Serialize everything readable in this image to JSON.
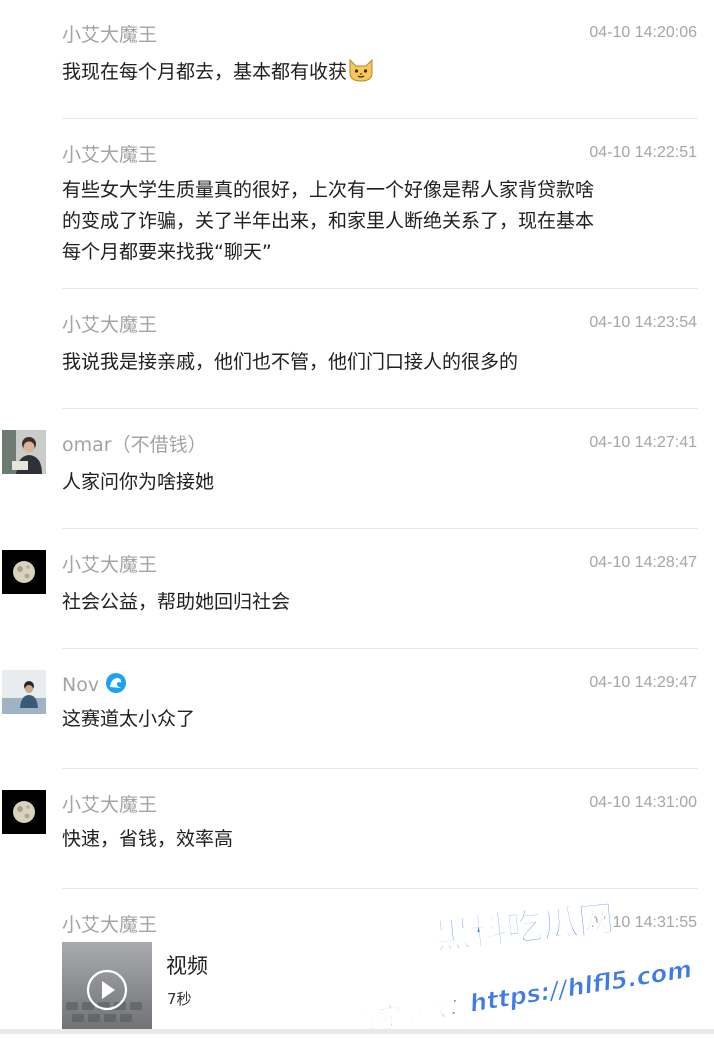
{
  "messages": [
    {
      "sender": "小艾大魔王",
      "time": "04-10 14:20:06",
      "text": "我现在每个月都去，基本都有收获",
      "emoji": "cat-face-emoji"
    },
    {
      "sender": "小艾大魔王",
      "time": "04-10 14:22:51",
      "lines": [
        "有些女大学生质量真的很好，上次有一个好像是帮人家背贷款啥",
        "的变成了诈骗，关了半年出来，和家里人断绝关系了，现在基本",
        "每个月都要来找我“聊天”"
      ]
    },
    {
      "sender": "小艾大魔王",
      "time": "04-10 14:23:54",
      "text": "我说我是接亲戚，他们也不管，他们门口接人的很多的"
    },
    {
      "sender": "omar（不借钱）",
      "time": "04-10 14:27:41",
      "text": "人家问你为啥接她",
      "avatar": "person-photo-avatar"
    },
    {
      "sender": "小艾大魔王",
      "time": "04-10 14:28:47",
      "text": "社会公益，帮助她回归社会",
      "avatar": "moon-avatar"
    },
    {
      "sender": "Nov",
      "time": "04-10 14:29:47",
      "text": "这赛道太小众了",
      "avatar": "person-photo-avatar",
      "badge": "wave-badge-icon"
    },
    {
      "sender": "小艾大魔王",
      "time": "04-10 14:31:00",
      "text": "快速，省钱，效率高",
      "avatar": "moon-avatar"
    },
    {
      "sender": "小艾大魔王",
      "time": "04-10 14:31:55"
    }
  ],
  "video": {
    "title": "视频",
    "duration": "7秒",
    "icon": "play-icon"
  },
  "watermark": {
    "line1": "黑料吃瓜网",
    "line2": "看完整版：https://hlfl5.com"
  }
}
